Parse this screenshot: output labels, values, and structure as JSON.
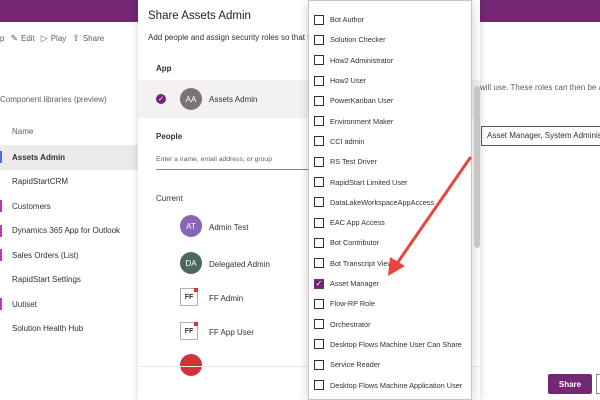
{
  "toolbar": {
    "partial": "p",
    "edit": "Edit",
    "play": "Play",
    "share": "Share",
    "edit_icon": "pencil-icon",
    "play_icon": "play-icon",
    "share_icon": "share-icon"
  },
  "breadcrumb": "Component libraries (preview)",
  "column_header": "Name",
  "apps": [
    {
      "label": "Assets Admin",
      "color": "#4f6bed"
    },
    {
      "label": "RapidStartCRM",
      "color": ""
    },
    {
      "label": "Customers",
      "color": "#c239b3"
    },
    {
      "label": "Dynamics 365 App for Outlook",
      "color": "#c239b3"
    },
    {
      "label": "Sales Orders (List)",
      "color": "#c239b3"
    },
    {
      "label": "RapidStart Settings",
      "color": ""
    },
    {
      "label": "Uutiset",
      "color": "#c239b3"
    },
    {
      "label": "Solution Health Hub",
      "color": ""
    }
  ],
  "panel": {
    "title": "Share Assets Admin",
    "subtitle": "Add people and assign security roles so that the",
    "app_section": "App",
    "app_initials": "AA",
    "app_name": "Assets Admin",
    "people_section": "People",
    "people_placeholder": "Enter a name, email address, or group",
    "current_section": "Current",
    "people": [
      {
        "initials": "AT",
        "name": "Admin Test",
        "color": "#8764b8"
      },
      {
        "initials": "DA",
        "name": "Delegated Admin",
        "color": "#486860"
      },
      {
        "initials": "FF",
        "name": "FF Admin",
        "color": ""
      },
      {
        "initials": "FF",
        "name": "FF App User",
        "color": ""
      },
      {
        "initials": "",
        "name": "",
        "color": "#d13438"
      }
    ]
  },
  "right": {
    "text": "will use. These roles can then be assi",
    "role_value": "Asset Manager, System Administrat",
    "share_label": "Share"
  },
  "dropdown": {
    "options": [
      {
        "label": "Bot Author",
        "checked": false
      },
      {
        "label": "Solution Checker",
        "checked": false
      },
      {
        "label": "How2 Administrator",
        "checked": false
      },
      {
        "label": "How2 User",
        "checked": false
      },
      {
        "label": "PowerKanban User",
        "checked": false
      },
      {
        "label": "Environment Maker",
        "checked": false
      },
      {
        "label": "CCI admin",
        "checked": false
      },
      {
        "label": "RS Test Driver",
        "checked": false
      },
      {
        "label": "RapidStart Limited User",
        "checked": false
      },
      {
        "label": "DataLakeWorkspaceAppAccess",
        "checked": false
      },
      {
        "label": "EAC App Access",
        "checked": false
      },
      {
        "label": "Bot Contributor",
        "checked": false
      },
      {
        "label": "Bot Transcript Viewer",
        "checked": false
      },
      {
        "label": "Asset Manager",
        "checked": true
      },
      {
        "label": "Flow-RP Role",
        "checked": false
      },
      {
        "label": "Orchestrator",
        "checked": false
      },
      {
        "label": "Desktop Flows Machine User Can Share",
        "checked": false
      },
      {
        "label": "Service Reader",
        "checked": false
      },
      {
        "label": "Desktop Flows Machine Application User",
        "checked": false
      },
      {
        "label": "Help Page Author",
        "checked": false
      }
    ]
  },
  "colors": {
    "brand": "#742774",
    "annotation_arrow": "#e8453c"
  }
}
